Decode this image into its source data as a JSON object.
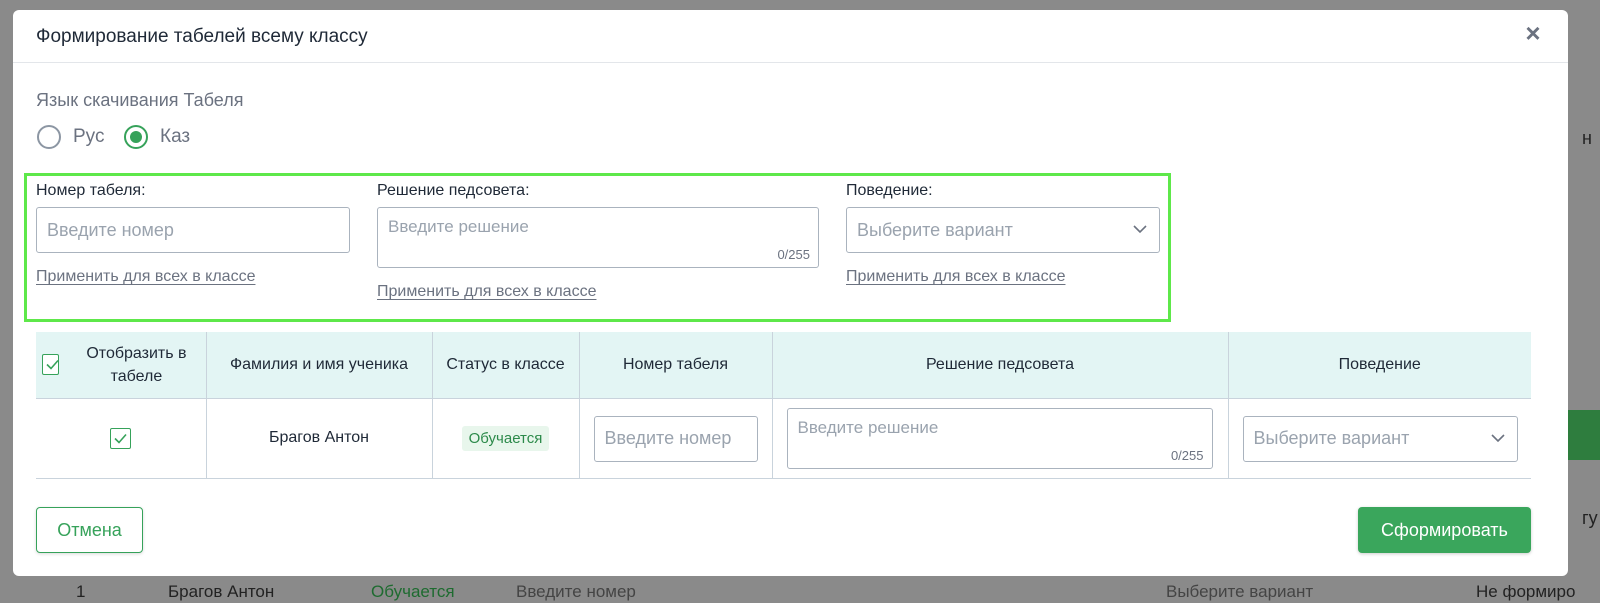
{
  "modal": {
    "title": "Формирование табелей всему классу",
    "close": "×"
  },
  "language": {
    "label": "Язык скачивания Табеля",
    "options": [
      {
        "label": "Рус",
        "checked": false
      },
      {
        "label": "Каз",
        "checked": true
      }
    ]
  },
  "bulk": {
    "number_label": "Номер табеля:",
    "number_placeholder": "Введите номер",
    "decision_label": "Решение педсовета:",
    "decision_placeholder": "Введите решение",
    "decision_counter": "0/255",
    "behavior_label": "Поведение:",
    "behavior_placeholder": "Выберите вариант",
    "apply_label": "Применить для всех в классе"
  },
  "table": {
    "headers": {
      "show": "Отобразить в табеле",
      "name": "Фамилия и имя ученика",
      "status": "Статус в классе",
      "number": "Номер табеля",
      "decision": "Решение педсовета",
      "behavior": "Поведение"
    },
    "rows": [
      {
        "name": "Брагов Антон",
        "status": "Обучается",
        "number_placeholder": "Введите номер",
        "decision_placeholder": "Введите решение",
        "decision_counter": "0/255",
        "behavior_placeholder": "Выберите вариант"
      }
    ]
  },
  "buttons": {
    "cancel": "Отмена",
    "submit": "Сформировать"
  },
  "background": {
    "row_index": "1",
    "row_name": "Брагов Антон",
    "row_status": "Обучается",
    "row_number_placeholder": "Введите номер",
    "row_behavior_placeholder": "Выберите вариант",
    "row_result": "Не формиро"
  },
  "colors": {
    "accent": "#36a25a",
    "highlight_box": "#5ee84a",
    "header_bg": "#e3f5f4"
  }
}
